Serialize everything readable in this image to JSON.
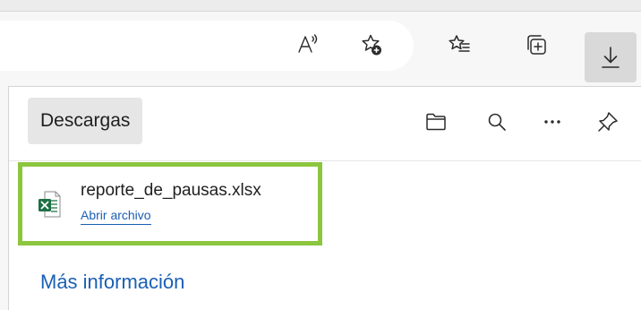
{
  "toolbar": {
    "read_aloud_icon": "read-aloud-icon",
    "add_favorite_icon": "add-favorite-icon",
    "favorites_icon": "favorites-icon",
    "collections_icon": "collections-icon",
    "downloads_icon": "download-icon"
  },
  "downloads_panel": {
    "title": "Descargas",
    "header_icons": [
      "folder-icon",
      "search-icon",
      "more-icon",
      "pin-icon"
    ],
    "items": [
      {
        "file_name": "reporte_de_pausas.xlsx",
        "action_label": "Abrir archivo",
        "file_type_icon": "excel-file-icon"
      }
    ],
    "more_info_link": "Más información"
  },
  "colors": {
    "highlight_border": "#8cc63e",
    "link": "#1a5fb4",
    "excel_green": "#1d7044"
  }
}
